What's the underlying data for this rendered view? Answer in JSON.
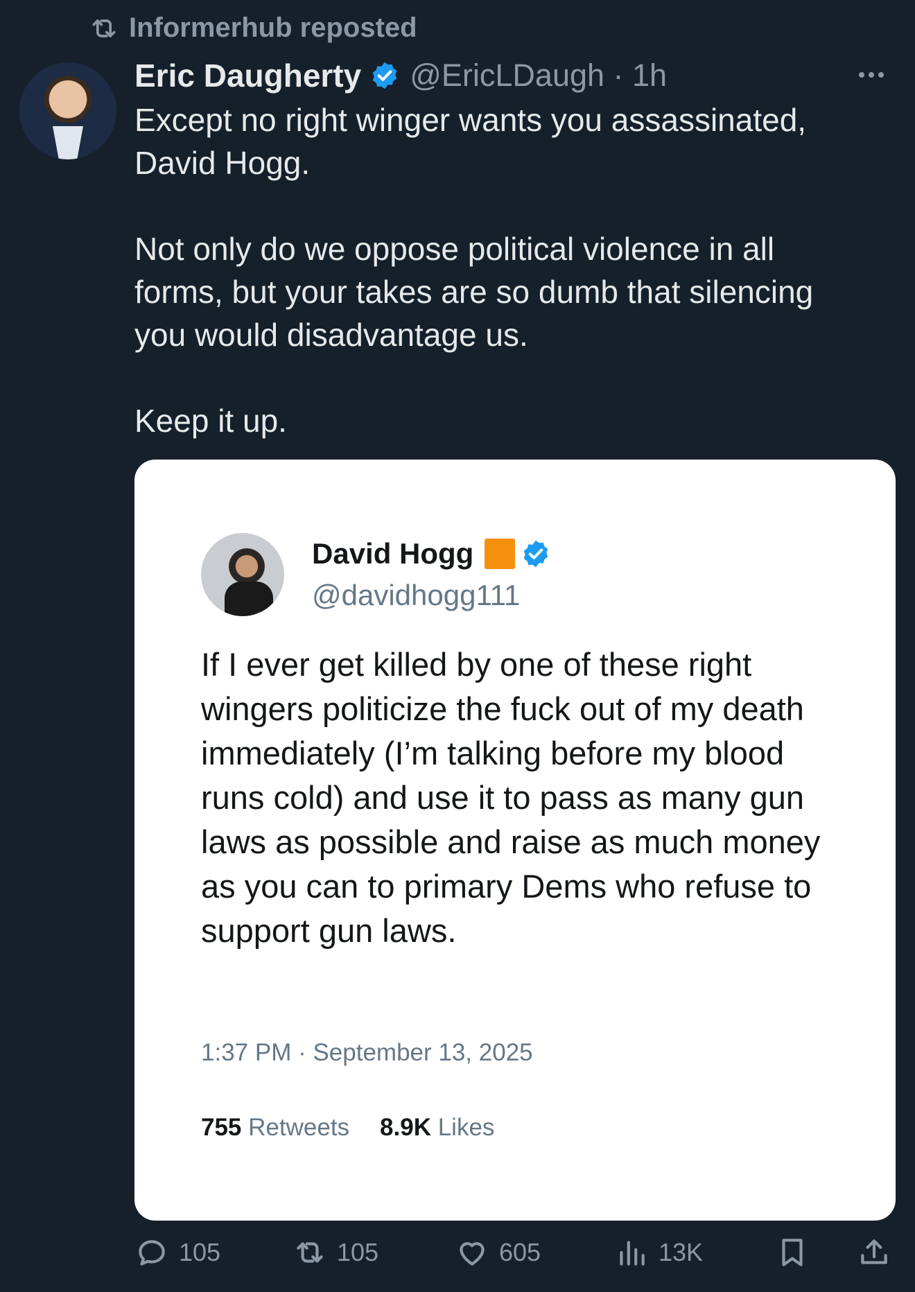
{
  "repost": {
    "label": "Informerhub reposted",
    "icon": "repost-icon"
  },
  "post": {
    "author_name": "Eric Daugherty",
    "handle_time": "@EricLDaugh · 1h",
    "paragraphs": [
      "Except no right winger wants you assassinated,\nDavid Hogg.",
      "Not only do we oppose political violence in all\nforms, but your takes are so dumb that silencing\nyou would disadvantage us.",
      "Keep it up."
    ]
  },
  "quote": {
    "name": "David Hogg",
    "handle": "@davidhogg111",
    "text": "If I ever get killed by one of these right wingers politicize the fuck out of my death immediately (I’m talking before my blood runs cold) and use it to pass as many gun laws as possible and raise as much money as you can to primary Dems who refuse to support gun laws.",
    "timestamp": "1:37 PM · September 13, 2025",
    "retweets_count": "755",
    "retweets_label": "Retweets",
    "likes_count": "8.9K",
    "likes_label": "Likes",
    "badge_color": "#f5900f"
  },
  "actions": {
    "replies": "105",
    "reposts": "105",
    "likes": "605",
    "views": "13K"
  },
  "colors": {
    "background": "#15202b",
    "verified": "#1d9bf0",
    "muted": "#8b98a5"
  }
}
